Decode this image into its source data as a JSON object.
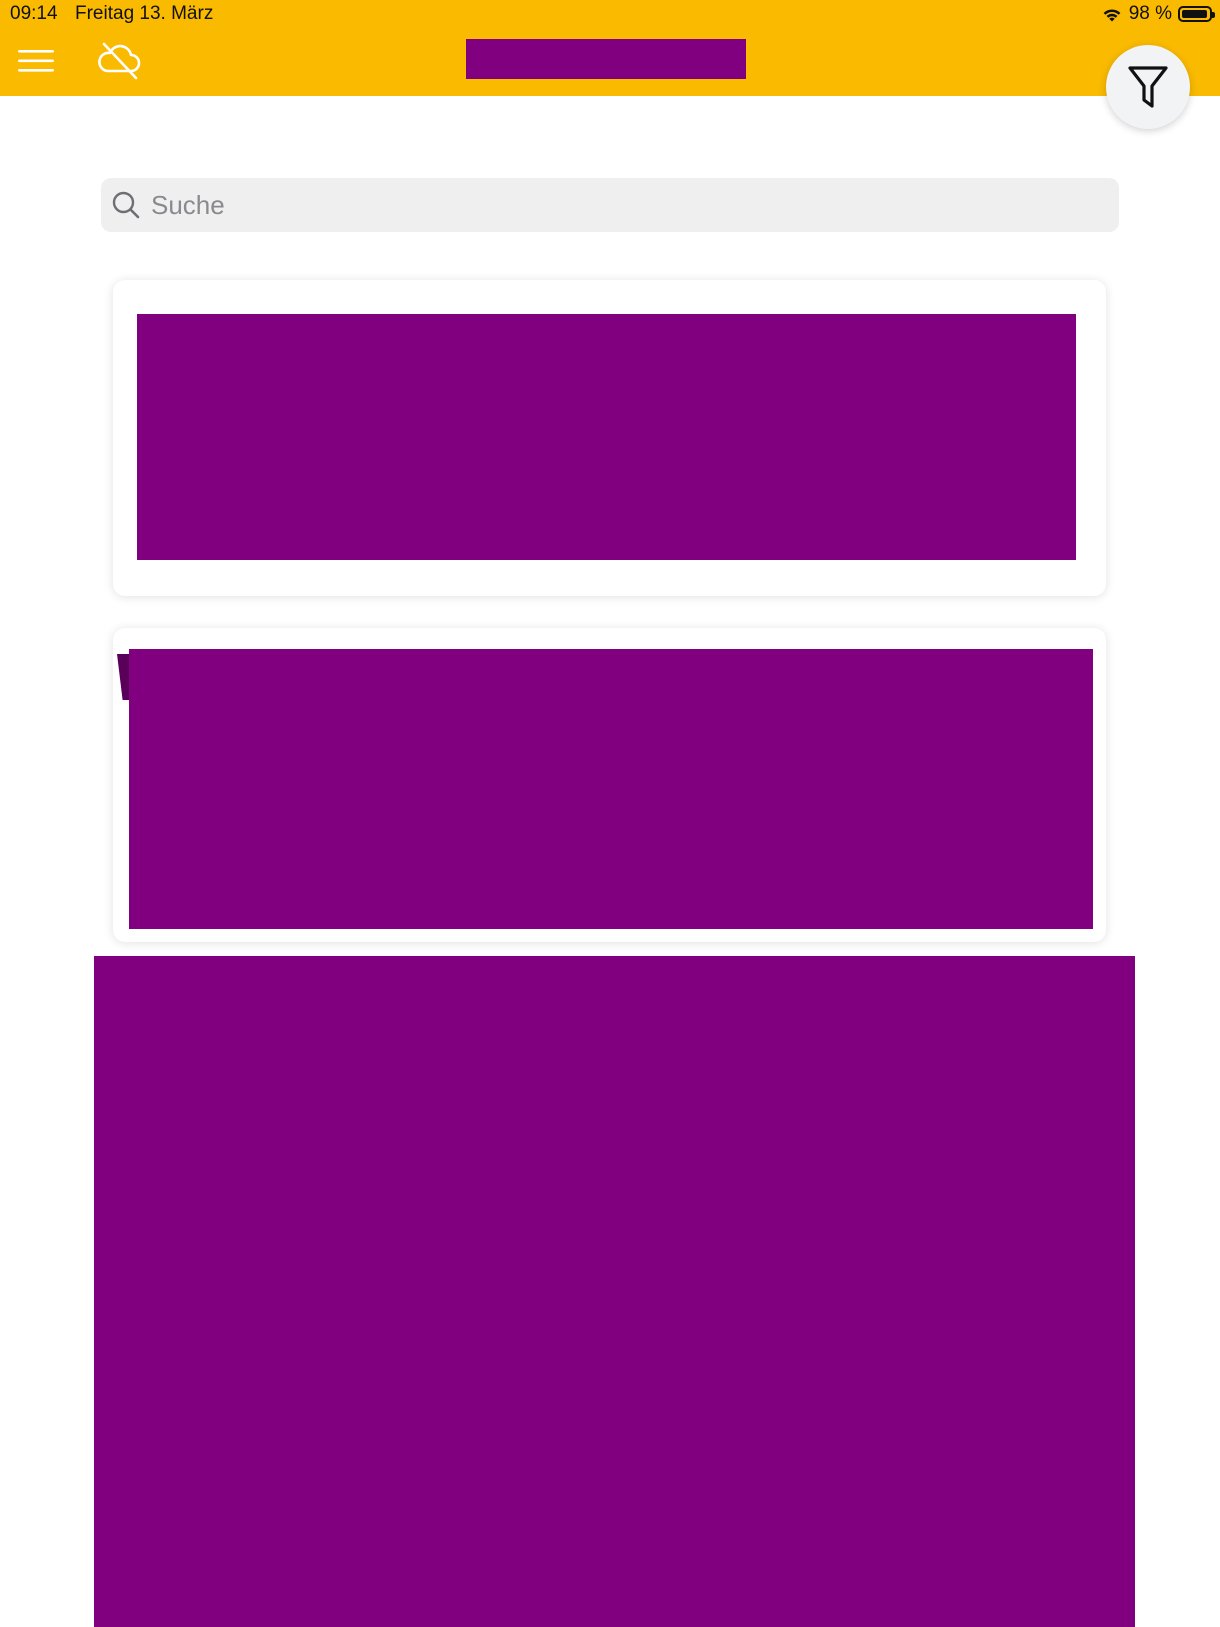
{
  "status_bar": {
    "time": "09:14",
    "date": "Freitag 13. März",
    "battery": "98 %",
    "battery_level": 0.98
  },
  "header": {
    "menu_icon": "hamburger-menu-icon",
    "cloud_icon": "cloud-offline-icon",
    "filter_icon": "filter-funnel-icon"
  },
  "search": {
    "placeholder": "Suche",
    "value": ""
  },
  "colors": {
    "header_bg": "#F9BA00",
    "redaction": "#800080",
    "search_bg": "#EFEFF0"
  }
}
